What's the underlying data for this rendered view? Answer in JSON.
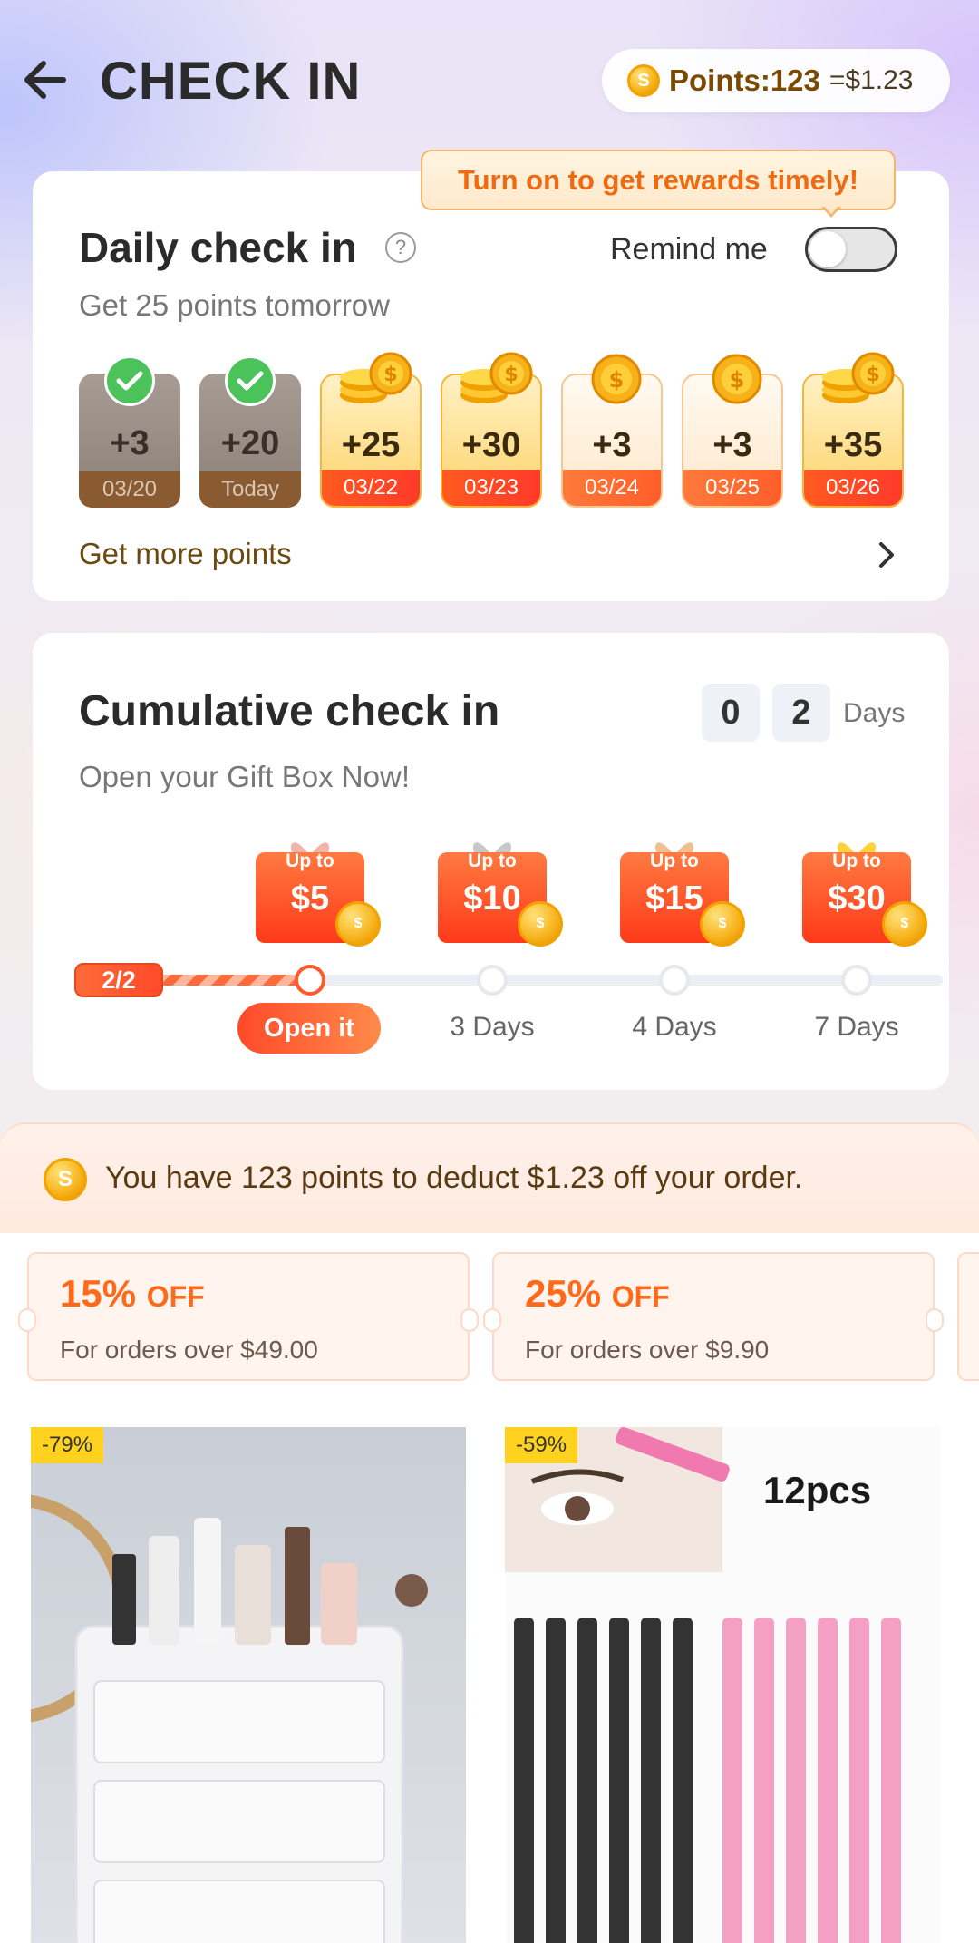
{
  "header": {
    "title": "CHECK IN",
    "points_label": "Points:123",
    "points_value": "=$1.23"
  },
  "daily": {
    "tooltip": "Turn on to get rewards timely!",
    "title": "Daily check in",
    "remind_label": "Remind me",
    "remind_on": false,
    "subtitle": "Get 25 points tomorrow",
    "days": [
      {
        "value": "+3",
        "date": "03/20",
        "status": "done"
      },
      {
        "value": "+20",
        "date": "Today",
        "status": "done"
      },
      {
        "value": "+25",
        "date": "03/22",
        "status": "big"
      },
      {
        "value": "+30",
        "date": "03/23",
        "status": "big"
      },
      {
        "value": "+3",
        "date": "03/24",
        "status": "small"
      },
      {
        "value": "+3",
        "date": "03/25",
        "status": "small"
      },
      {
        "value": "+35",
        "date": "03/26",
        "status": "big"
      }
    ],
    "more_points": "Get more points"
  },
  "cumulative": {
    "title": "Cumulative check in",
    "digits": [
      "0",
      "2"
    ],
    "days_label": "Days",
    "subtitle": "Open your Gift Box Now!",
    "progress": "2/2",
    "gifts": [
      {
        "upto": "Up to",
        "amount": "$5",
        "label": "Open it"
      },
      {
        "upto": "Up to",
        "amount": "$10",
        "label": "3 Days"
      },
      {
        "upto": "Up to",
        "amount": "$15",
        "label": "4 Days"
      },
      {
        "upto": "Up to",
        "amount": "$30",
        "label": "7 Days"
      }
    ]
  },
  "rewards": {
    "notice": "You have 123 points to deduct $1.23 off your order.",
    "coupons": [
      {
        "pct": "15%",
        "off": "OFF",
        "desc": "For orders over $49.00"
      },
      {
        "pct": "25%",
        "off": "OFF",
        "desc": "For orders over $9.90"
      }
    ]
  },
  "products": [
    {
      "discount": "-79%"
    },
    {
      "discount": "-59%",
      "caption": "12pcs"
    }
  ]
}
